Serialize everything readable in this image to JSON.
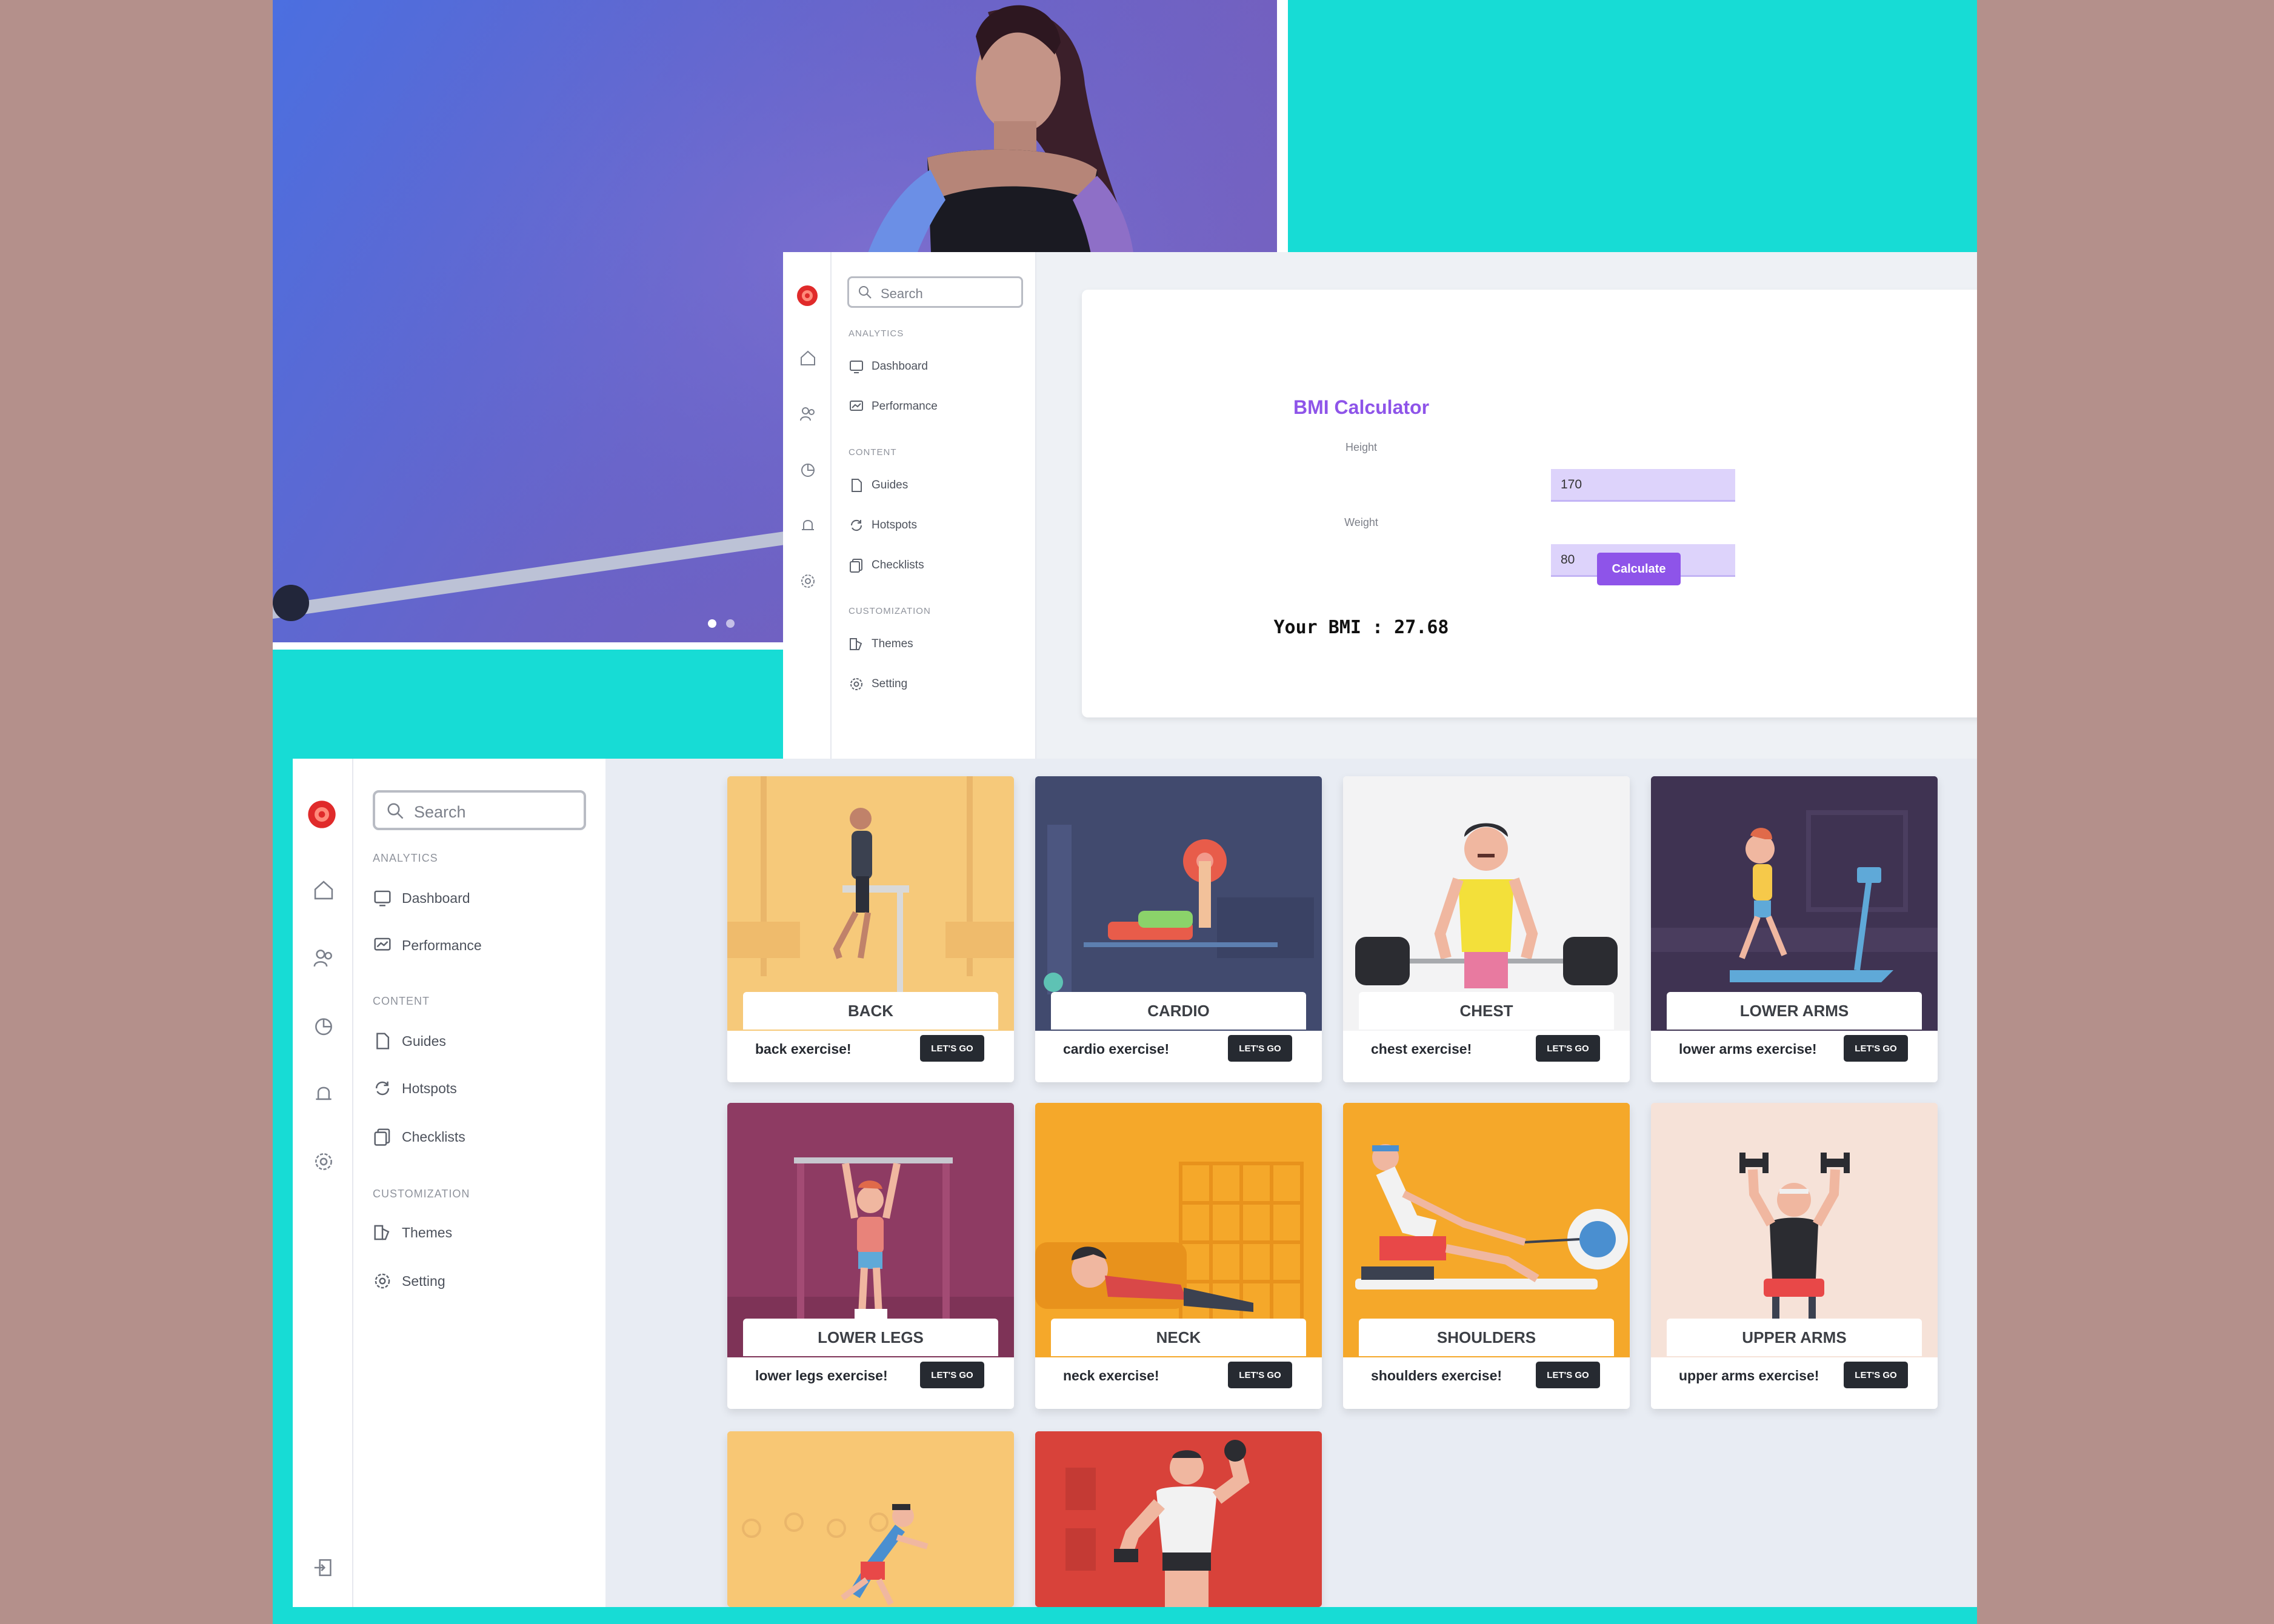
{
  "colors": {
    "background": "#b4908b",
    "teal": "#17dcd5",
    "accent_purple": "#8e54e9",
    "input_fill": "#ddd3fb",
    "dark_button": "#262a31",
    "logo_red": "#e02a2a"
  },
  "hero": {
    "icon": "woman-weightlifting-photo",
    "carousel_dots": 2
  },
  "bmi_window": {
    "search": {
      "placeholder": "Search"
    },
    "sections": {
      "analytics": "ANALYTICS",
      "content": "CONTENT",
      "customization": "CUSTOMIZATION"
    },
    "menu": {
      "dashboard": "Dashboard",
      "performance": "Performance",
      "guides": "Guides",
      "hotspots": "Hotspots",
      "checklists": "Checklists",
      "themes": "Themes",
      "setting": "Setting"
    },
    "calculator": {
      "title": "BMI Calculator",
      "height_label": "Height",
      "height_value": "170",
      "weight_label": "Weight",
      "weight_value": "80",
      "button": "Calculate",
      "result": "Your BMI : 27.68"
    }
  },
  "exercise_window": {
    "search": {
      "placeholder": "Search"
    },
    "sections": {
      "analytics": "ANALYTICS",
      "content": "CONTENT",
      "customization": "CUSTOMIZATION"
    },
    "menu": {
      "dashboard": "Dashboard",
      "performance": "Performance",
      "guides": "Guides",
      "hotspots": "Hotspots",
      "checklists": "Checklists",
      "themes": "Themes",
      "setting": "Setting"
    },
    "cards": [
      {
        "title": "BACK",
        "desc": "back exercise!",
        "button": "LET'S GO",
        "bg": "#f6c97a",
        "icon": "pullup-bar-illustration"
      },
      {
        "title": "CARDIO",
        "desc": "cardio exercise!",
        "button": "LET'S GO",
        "bg": "#414a6e",
        "icon": "bench-press-illustration"
      },
      {
        "title": "CHEST",
        "desc": "chest exercise!",
        "button": "LET'S GO",
        "bg": "#f3f3f4",
        "icon": "deadlift-illustration"
      },
      {
        "title": "LOWER ARMS",
        "desc": "lower arms exercise!",
        "button": "LET'S GO",
        "bg": "#3f3352",
        "icon": "treadmill-illustration"
      },
      {
        "title": "LOWER LEGS",
        "desc": "lower legs exercise!",
        "button": "LET'S GO",
        "bg": "#8e3b63",
        "icon": "hanging-bar-illustration"
      },
      {
        "title": "NECK",
        "desc": "neck exercise!",
        "button": "LET'S GO",
        "bg": "#f5a82a",
        "icon": "resting-man-illustration"
      },
      {
        "title": "SHOULDERS",
        "desc": "shoulders exercise!",
        "button": "LET'S GO",
        "bg": "#f5a82a",
        "icon": "rowing-machine-illustration"
      },
      {
        "title": "UPPER ARMS",
        "desc": "upper arms exercise!",
        "button": "LET'S GO",
        "bg": "#f6e2d8",
        "icon": "dumbbell-press-illustration"
      },
      {
        "bg": "#f8c774",
        "icon": "running-man-illustration"
      },
      {
        "bg": "#d8423a",
        "icon": "bodybuilder-illustration"
      }
    ]
  }
}
